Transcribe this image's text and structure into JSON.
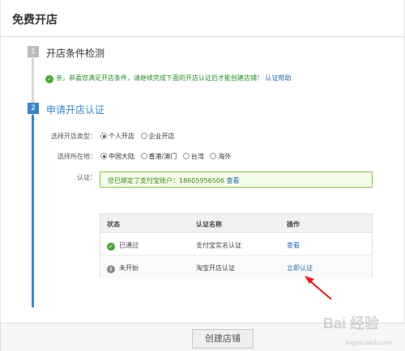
{
  "header": {
    "title": "免费开店"
  },
  "step1": {
    "number": "1",
    "title": "开店条件检测",
    "notice": "亲，恭喜您满足开店条件，请继续完成下面的开店认证后才能创建店铺！",
    "notice_link": "认证帮助"
  },
  "step2": {
    "number": "2",
    "title": "申请开店认证",
    "shop_type": {
      "label": "选择开店类型：",
      "options": [
        "个人开店",
        "企业开店"
      ],
      "selected": "个人开店"
    },
    "region": {
      "label": "选择所在地：",
      "options": [
        "中国大陆",
        "香港/澳门",
        "台湾",
        "海外"
      ],
      "selected": "中国大陆"
    },
    "verify": {
      "label": "认证：",
      "text": "您已绑定了支付宝账户：18605956506",
      "link": "查看"
    },
    "table": {
      "headers": [
        "状态",
        "认证名称",
        "操作"
      ],
      "rows": [
        {
          "status": "已通过",
          "name": "支付宝实名认证",
          "action": "查看",
          "status_icon": "check-circle-icon"
        },
        {
          "status": "未开始",
          "name": "淘宝开店认证",
          "action": "立即认证",
          "status_icon": "info-circle-icon"
        }
      ]
    }
  },
  "footer": {
    "submit_label": "创建店铺"
  },
  "watermark": {
    "text": "Bai 经验",
    "sub": "jingyan.baidu.com"
  },
  "colors": {
    "accent": "#3a86c8",
    "success": "#49a637",
    "link": "#2a6bb0",
    "arrow": "#e02020"
  }
}
